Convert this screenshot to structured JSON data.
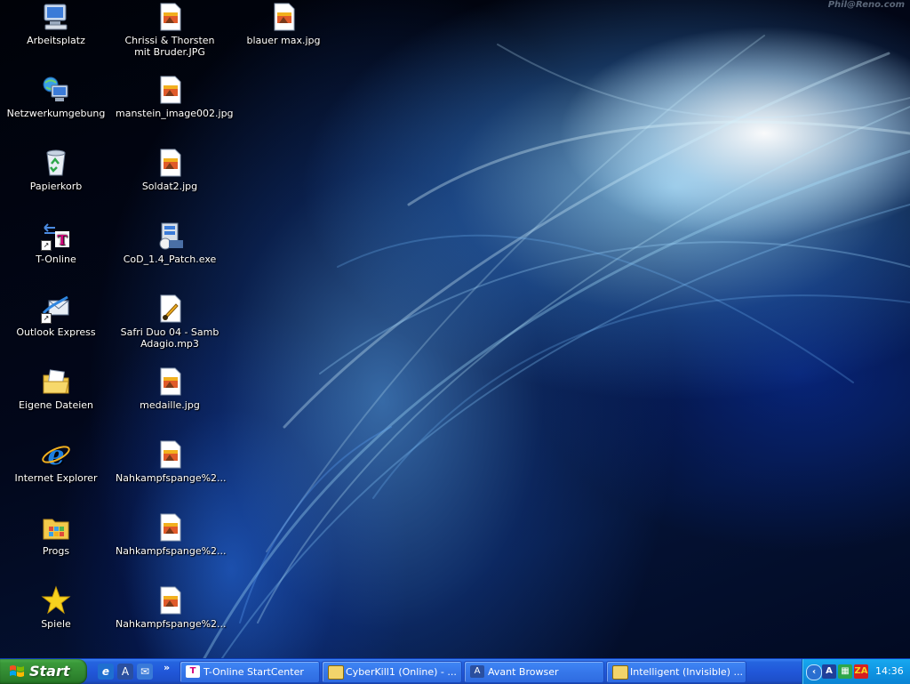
{
  "watermark": "Phil@Reno.com",
  "desktop": {
    "icons": [
      {
        "label": "Arbeitsplatz",
        "icon": "my-computer-icon"
      },
      {
        "label": "Netzwerkumgebung",
        "icon": "network-places-icon"
      },
      {
        "label": "Papierkorb",
        "icon": "recycle-bin-icon"
      },
      {
        "label": "T-Online",
        "icon": "t-online-icon"
      },
      {
        "label": "Outlook Express",
        "icon": "outlook-express-icon"
      },
      {
        "label": "Eigene Dateien",
        "icon": "my-documents-icon"
      },
      {
        "label": "Internet Explorer",
        "icon": "internet-explorer-icon"
      },
      {
        "label": "Progs",
        "icon": "folder-icon"
      },
      {
        "label": "Spiele",
        "icon": "star-icon"
      },
      {
        "label": "Chrissi & Thorsten mit Bruder.JPG",
        "icon": "image-file-icon"
      },
      {
        "label": "manstein_image002.jpg",
        "icon": "image-file-icon"
      },
      {
        "label": "Soldat2.jpg",
        "icon": "image-file-icon"
      },
      {
        "label": "CoD_1.4_Patch.exe",
        "icon": "installer-icon"
      },
      {
        "label": "Safri Duo 04 - Samb Adagio.mp3",
        "icon": "audio-file-icon"
      },
      {
        "label": "medaille.jpg",
        "icon": "image-file-icon"
      },
      {
        "label": "Nahkampfspange%2...",
        "icon": "image-file-icon"
      },
      {
        "label": "Nahkampfspange%2...",
        "icon": "image-file-icon"
      },
      {
        "label": "Nahkampfspange%2...",
        "icon": "image-file-icon"
      },
      {
        "label": "blauer max.jpg",
        "icon": "image-file-icon"
      }
    ]
  },
  "taskbar": {
    "start_label": "Start",
    "quick_launch": [
      {
        "icon": "internet-explorer-icon",
        "glyph": "e"
      },
      {
        "icon": "avant-browser-icon",
        "glyph": "A"
      },
      {
        "icon": "outlook-express-icon",
        "glyph": "✉"
      }
    ],
    "quick_launch_more": "»",
    "tasks": [
      {
        "label": "T-Online StartCenter",
        "icon": "t-online-icon"
      },
      {
        "label": "CyberKill1 (Online) - ...",
        "icon": "icq-window-icon"
      },
      {
        "label": "Avant Browser",
        "icon": "avant-browser-icon"
      },
      {
        "label": "Intelligent (Invisible) ...",
        "icon": "icq-window-icon"
      }
    ],
    "tray": {
      "clock": "14:36",
      "icons": [
        "tray-expand-icon",
        "avant-browser-icon",
        "network-status-icon",
        "zonealarm-icon"
      ],
      "zonealarm_label": "ZA"
    }
  },
  "colors": {
    "taskbar_blue": "#2157d9",
    "start_green": "#328a32",
    "tray_blue": "#0f95e3"
  }
}
